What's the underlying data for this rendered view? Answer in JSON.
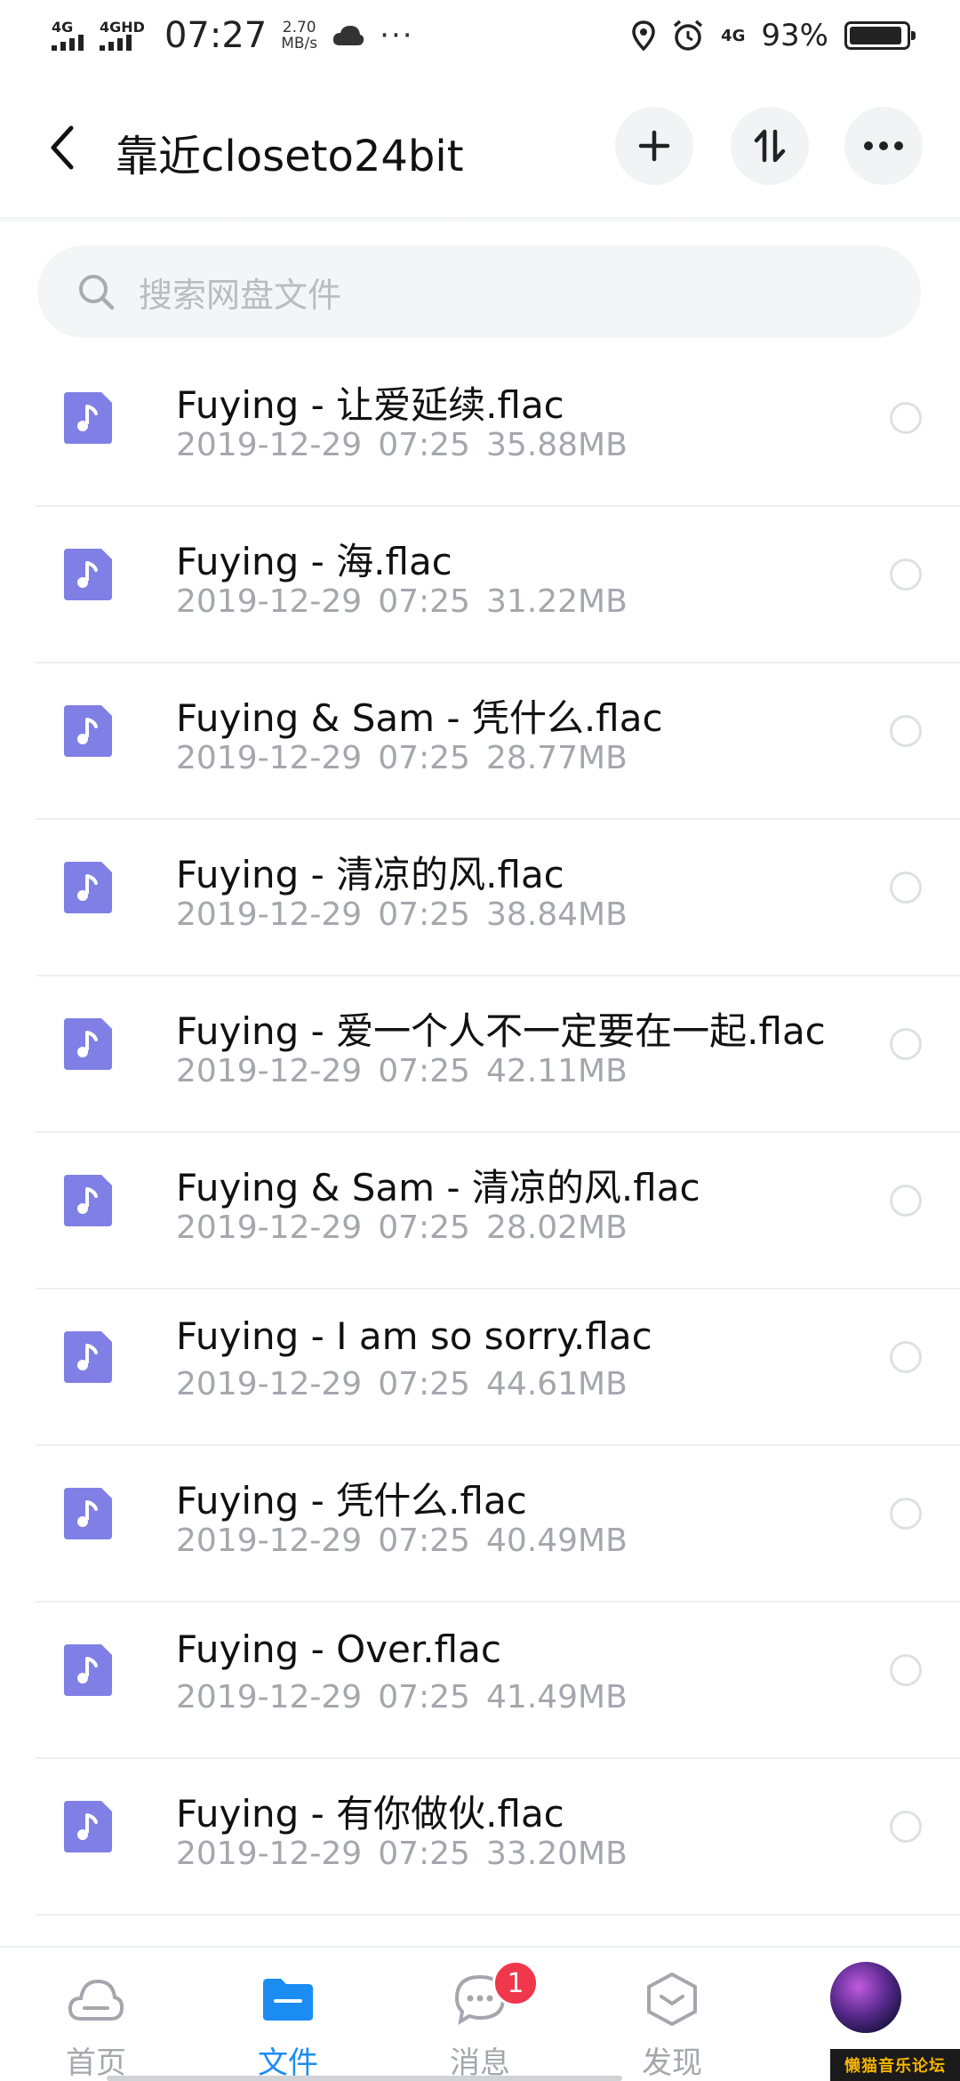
{
  "status_bar": {
    "net1": "4G",
    "net2": "4GHD",
    "time": "07:27",
    "speed_value": "2.70",
    "speed_unit": "MB/s",
    "dots": "···",
    "net3": "4G",
    "battery": "93%",
    "battery_level": 0.93
  },
  "header": {
    "title": "靠近closeto24bit"
  },
  "search": {
    "placeholder": "搜索网盘文件"
  },
  "files": [
    {
      "name": "Fuying - 让爱延续.flac",
      "date": "2019-12-29",
      "time": "07:25",
      "size": "35.88MB"
    },
    {
      "name": "Fuying - 海.flac",
      "date": "2019-12-29",
      "time": "07:25",
      "size": "31.22MB"
    },
    {
      "name": "Fuying & Sam - 凭什么.flac",
      "date": "2019-12-29",
      "time": "07:25",
      "size": "28.77MB"
    },
    {
      "name": "Fuying - 清凉的风.flac",
      "date": "2019-12-29",
      "time": "07:25",
      "size": "38.84MB"
    },
    {
      "name": "Fuying - 爱一个人不一定要在一起.flac",
      "date": "2019-12-29",
      "time": "07:25",
      "size": "42.11MB"
    },
    {
      "name": "Fuying & Sam - 清凉的风.flac",
      "date": "2019-12-29",
      "time": "07:25",
      "size": "28.02MB"
    },
    {
      "name": "Fuying - I am so sorry.flac",
      "date": "2019-12-29",
      "time": "07:25",
      "size": "44.61MB"
    },
    {
      "name": "Fuying - 凭什么.flac",
      "date": "2019-12-29",
      "time": "07:25",
      "size": "40.49MB"
    },
    {
      "name": "Fuying - Over.flac",
      "date": "2019-12-29",
      "time": "07:25",
      "size": "41.49MB"
    },
    {
      "name": "Fuying - 有你做伙.flac",
      "date": "2019-12-29",
      "time": "07:25",
      "size": "33.20MB"
    }
  ],
  "nav": {
    "home": "首页",
    "files": "文件",
    "messages": "消息",
    "messages_badge": "1",
    "discover": "发现"
  },
  "watermark": "懒猫音乐论坛",
  "colors": {
    "accent": "#1b8cf2",
    "file_icon": "#7f7fe6",
    "badge": "#f0374c"
  }
}
